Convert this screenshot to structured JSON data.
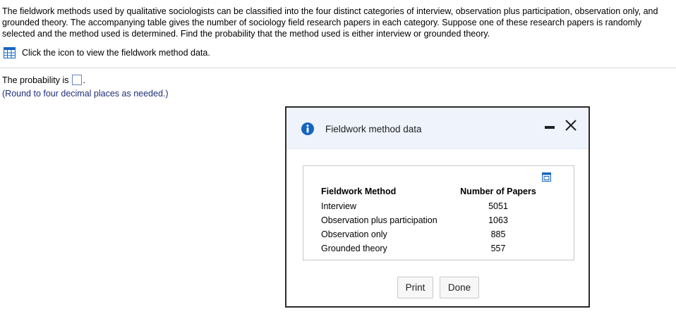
{
  "question": {
    "text": "The fieldwork methods used by qualitative sociologists can be classified into the four distinct categories of interview, observation plus participation, observation only, and grounded theory. The accompanying table gives the number of sociology field research papers in each category. Suppose one of these research papers is randomly selected and the method used is determined. Find the probability that the method used is either interview or grounded theory."
  },
  "data_link": {
    "label": "Click the icon to view the fieldwork method data.",
    "icon": "table-icon"
  },
  "answer": {
    "prefix": "The probability is",
    "value": "",
    "suffix": ".",
    "note": "(Round to four decimal places as needed.)"
  },
  "dialog": {
    "title": "Fieldwork method data",
    "icon": "info-icon",
    "columns": [
      "Fieldwork Method",
      "Number of Papers"
    ],
    "rows": [
      {
        "method": "Interview",
        "count": "5051"
      },
      {
        "method": "Observation plus participation",
        "count": "1063"
      },
      {
        "method": "Observation only",
        "count": "885"
      },
      {
        "method": "Grounded theory",
        "count": "557"
      }
    ],
    "buttons": {
      "print": "Print",
      "done": "Done"
    }
  },
  "colors": {
    "accent": "#1565c0",
    "header_bg": "#eef3fc",
    "note_text": "#1f2f7a"
  }
}
